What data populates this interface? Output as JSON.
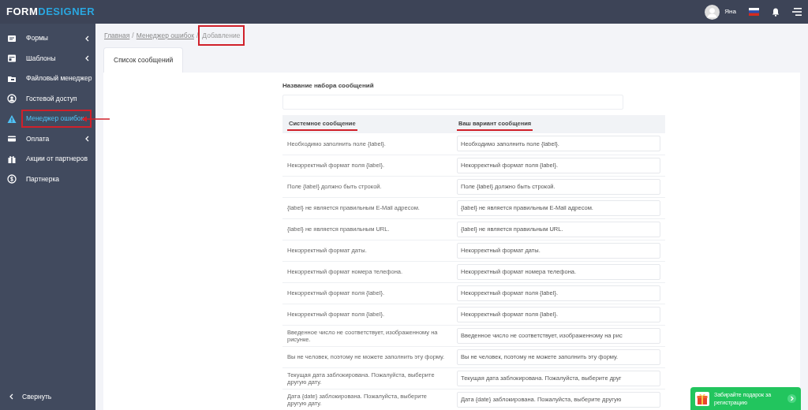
{
  "brand": {
    "part1": "FORM",
    "part2": "DESIGNER"
  },
  "topbar": {
    "user_name": "Яна"
  },
  "sidebar": {
    "items": [
      {
        "label": "Формы",
        "has_submenu": true,
        "selected": false,
        "highlighted": false
      },
      {
        "label": "Шаблоны",
        "has_submenu": true,
        "selected": false,
        "highlighted": false
      },
      {
        "label": "Файловый менеджер",
        "has_submenu": false,
        "selected": false,
        "highlighted": false
      },
      {
        "label": "Гостевой доступ",
        "has_submenu": false,
        "selected": false,
        "highlighted": false
      },
      {
        "label": "Менеджер ошибок",
        "has_submenu": false,
        "selected": true,
        "highlighted": true
      },
      {
        "label": "Оплата",
        "has_submenu": true,
        "selected": false,
        "highlighted": false
      },
      {
        "label": "Акции от партнеров",
        "has_submenu": false,
        "selected": false,
        "highlighted": false
      },
      {
        "label": "Партнерка",
        "has_submenu": false,
        "selected": false,
        "highlighted": false
      }
    ],
    "collapse": "Свернуть"
  },
  "breadcrumb_separator": "/",
  "breadcrumb": [
    {
      "label": "Главная",
      "link": true,
      "highlighted": false
    },
    {
      "label": "Менеджер ошибок",
      "link": true,
      "highlighted": false
    },
    {
      "label": "Добавление",
      "link": false,
      "highlighted": true
    }
  ],
  "tabs": [
    {
      "label": "Список сообщений",
      "selected": true
    }
  ],
  "name_field": {
    "label": "Название набора сообщений"
  },
  "table": {
    "columns": [
      {
        "label": "Системное сообщение",
        "underlined": true
      },
      {
        "label": "Ваш вариант сообщения",
        "underlined": true
      }
    ],
    "rows": [
      {
        "system": "Необходимо заполнить поле {label}.",
        "custom": "Необходимо заполнить поле {label}."
      },
      {
        "system": "Некорректный формат поля {label}.",
        "custom": "Некорректный формат поля {label}."
      },
      {
        "system": "Поле {label} должно быть строкой.",
        "custom": "Поле {label} должно быть строкой."
      },
      {
        "system": "{label} не является правильным E-Mail адресом.",
        "custom": "{label} не является правильным E-Mail адресом."
      },
      {
        "system": "{label} не является правильным URL.",
        "custom": "{label} не является правильным URL."
      },
      {
        "system": "Некорректный формат даты.",
        "custom": "Некорректный формат даты."
      },
      {
        "system": "Некорректный формат номера телефона.",
        "custom": "Некорректный формат номера телефона."
      },
      {
        "system": "Некорректный формат поля {label}.",
        "custom": "Некорректный формат поля {label}."
      },
      {
        "system": "Некорректный формат поля {label}.",
        "custom": "Некорректный формат поля {label}."
      },
      {
        "system": "Введенное число не соответствует, изображенному на рисунке.",
        "custom": "Введенное число не соответствует, изображенному на рис"
      },
      {
        "system": "Вы не человек, поэтому не можете заполнить эту форму.",
        "custom": "Вы не человек, поэтому не можете заполнить эту форму."
      },
      {
        "system": "Текущая дата заблокирована. Пожалуйста, выберите другую дату.",
        "custom": "Текущая дата заблокирована. Пожалуйста, выберите друг"
      },
      {
        "system": "Дата {date} заблокирована. Пожалуйста, выберите другую дату.",
        "custom": "Дата {date} заблокирована. Пожалуйста, выберите другую"
      }
    ]
  },
  "promo": {
    "text": "Забирайте подарок за регистрацию"
  }
}
